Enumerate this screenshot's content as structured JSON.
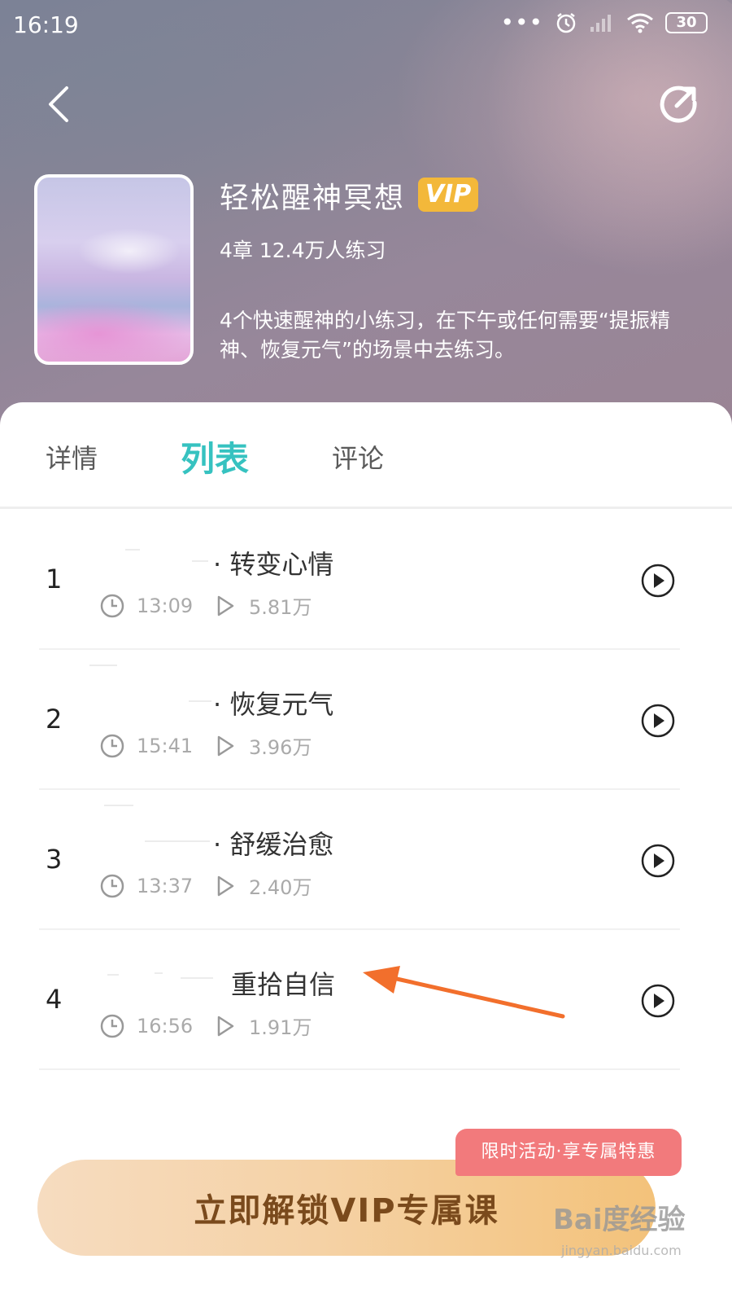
{
  "status_bar": {
    "time": "16:19",
    "battery": "30",
    "icons": [
      "more-dots-icon",
      "alarm-icon",
      "signal-icon",
      "wifi-icon",
      "battery-icon"
    ]
  },
  "header": {
    "back_icon": "chevron-left-icon",
    "share_icon": "share-icon"
  },
  "course": {
    "title": "轻松醒神冥想",
    "badge": "VIP",
    "meta": "4章 12.4万人练习",
    "description": "4个快速醒神的小练习，在下午或任何需要“提振精神、恢复元气”的场景中去练习。"
  },
  "tabs": [
    {
      "label": "详情",
      "active": false
    },
    {
      "label": "列表",
      "active": true
    },
    {
      "label": "评论",
      "active": false
    }
  ],
  "accent_color": "#36c2c0",
  "lessons": [
    {
      "num": "1",
      "title": "· 转变心情",
      "duration": "13:09",
      "plays": "5.81万"
    },
    {
      "num": "2",
      "title": "· 恢复元气",
      "duration": "15:41",
      "plays": "3.96万"
    },
    {
      "num": "3",
      "title": "· 舒缓治愈",
      "duration": "13:37",
      "plays": "2.40万"
    },
    {
      "num": "4",
      "title": "重拾自信",
      "duration": "16:56",
      "plays": "1.91万"
    }
  ],
  "promo": {
    "tag": "限时活动·享专属特惠",
    "button": "立即解锁VIP专属课"
  },
  "watermark": {
    "main": "Bai度经验",
    "sub": "jingyan.baidu.com"
  }
}
